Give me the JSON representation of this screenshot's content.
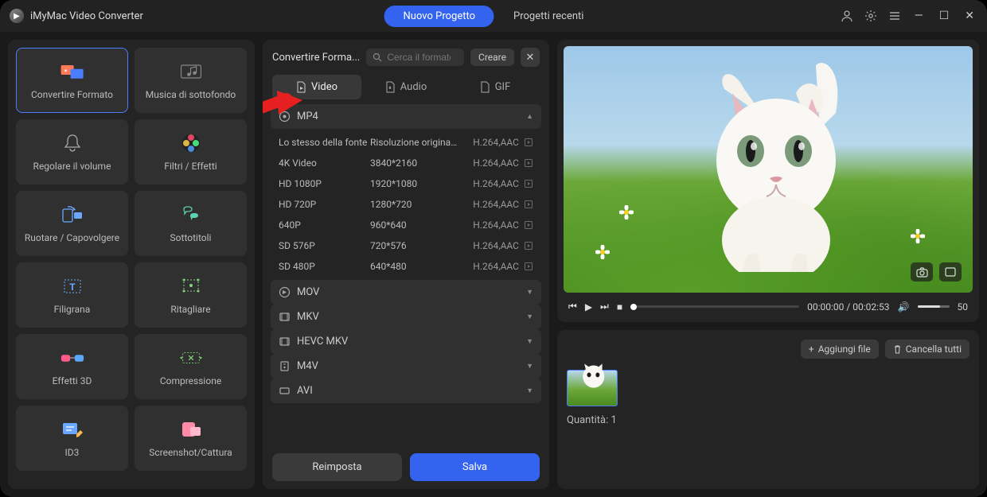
{
  "app": {
    "title": "iMyMac Video Converter"
  },
  "tabs": {
    "new_project": "Nuovo Progetto",
    "recent_projects": "Progetti recenti"
  },
  "sidebar": {
    "items": [
      {
        "label": "Convertire Formato"
      },
      {
        "label": "Musica di sottofondo"
      },
      {
        "label": "Regolare il volume"
      },
      {
        "label": "Filtri / Effetti"
      },
      {
        "label": "Ruotare / Capovolgere"
      },
      {
        "label": "Sottotitoli"
      },
      {
        "label": "Filigrana"
      },
      {
        "label": "Ritagliare"
      },
      {
        "label": "Effetti 3D"
      },
      {
        "label": "Compressione"
      },
      {
        "label": "ID3"
      },
      {
        "label": "Screenshot/Cattura"
      }
    ]
  },
  "center": {
    "title": "Convertire Forma...",
    "search_placeholder": "Cerca il formato",
    "create": "Creare",
    "subtabs": {
      "video": "Video",
      "audio": "Audio",
      "gif": "GIF"
    },
    "mp4": {
      "header": "MP4",
      "rows": [
        {
          "name": "Lo stesso della fonte",
          "res": "Risoluzione originale",
          "codec": "H.264,AAC"
        },
        {
          "name": "4K Video",
          "res": "3840*2160",
          "codec": "H.264,AAC"
        },
        {
          "name": "HD 1080P",
          "res": "1920*1080",
          "codec": "H.264,AAC"
        },
        {
          "name": "HD 720P",
          "res": "1280*720",
          "codec": "H.264,AAC"
        },
        {
          "name": "640P",
          "res": "960*640",
          "codec": "H.264,AAC"
        },
        {
          "name": "SD 576P",
          "res": "720*576",
          "codec": "H.264,AAC"
        },
        {
          "name": "SD 480P",
          "res": "640*480",
          "codec": "H.264,AAC"
        }
      ]
    },
    "collapsed": [
      "MOV",
      "MKV",
      "HEVC MKV",
      "M4V",
      "AVI"
    ],
    "reset": "Reimposta",
    "save": "Salva"
  },
  "player": {
    "time_current": "00:00:00",
    "time_total": "00:02:53",
    "volume": "50"
  },
  "filelist": {
    "add": "Aggiungi file",
    "clear": "Cancella tutti",
    "quantity_label": "Quantità:",
    "quantity_value": "1"
  }
}
